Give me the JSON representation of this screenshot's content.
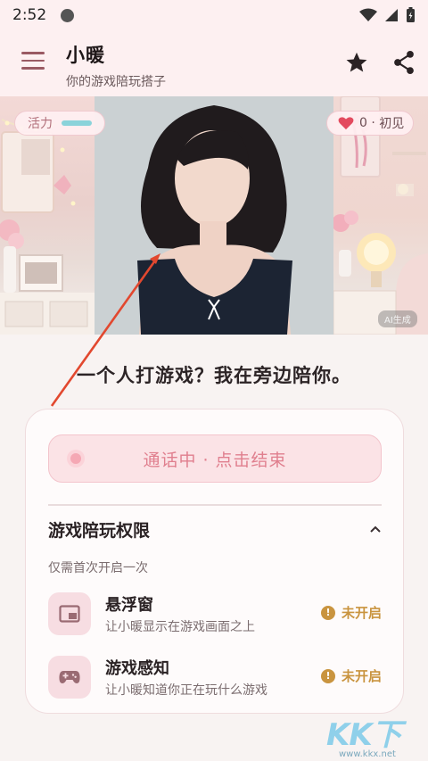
{
  "status_bar": {
    "time": "2:52"
  },
  "app_bar": {
    "title": "小暖",
    "subtitle": "你的游戏陪玩搭子",
    "icons": [
      "menu-icon",
      "star-icon",
      "share-icon"
    ]
  },
  "hero": {
    "energy_label": "活力",
    "affection_count": "0",
    "affection_stage": "初见",
    "ai_badge": "AI生成"
  },
  "tagline": "一个人打游戏？我在旁边陪你。",
  "call": {
    "label": "通话中 · 点击结束"
  },
  "permissions": {
    "title": "游戏陪玩权限",
    "note": "仅需首次开启一次",
    "items": [
      {
        "name": "悬浮窗",
        "desc": "让小暖显示在游戏画面之上",
        "status": "未开启",
        "icon": "picture-in-picture-icon"
      },
      {
        "name": "游戏感知",
        "desc": "让小暖知道你正在玩什么游戏",
        "status": "未开启",
        "icon": "gamepad-icon"
      }
    ]
  },
  "watermark": {
    "brand": "KK下载",
    "url": "www.kkx.net"
  },
  "colors": {
    "accent": "#e07f8e",
    "warning": "#c9943f",
    "app_bar_bg": "#fdf0f1"
  }
}
